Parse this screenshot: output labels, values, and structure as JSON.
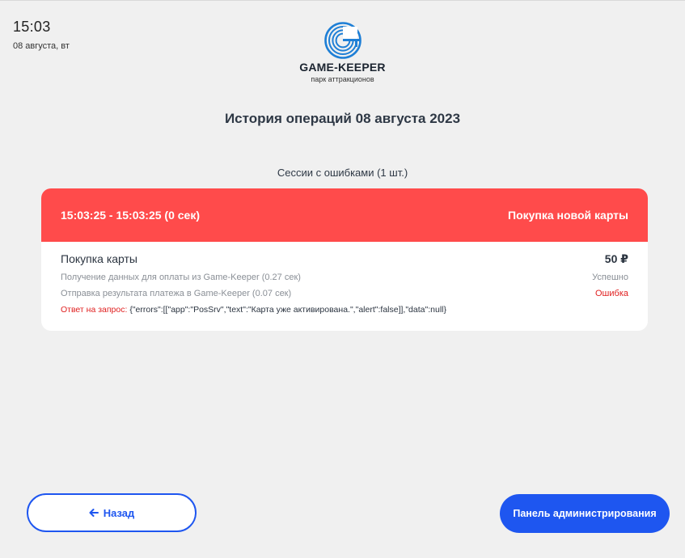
{
  "clock": {
    "time": "15:03",
    "date": "08 августа, вт"
  },
  "brand": {
    "name": "GAME-KEEPER",
    "subtitle": "парк аттракционов",
    "color": "#1e7fd6"
  },
  "page_title": "История операций 08 августа 2023",
  "section_title": "Сессии с ошибками (1 шт.)",
  "session": {
    "time_range": "15:03:25 - 15:03:25 (0 сек)",
    "operation": "Покупка новой карты",
    "header_color": "#ff4b4b",
    "item_name": "Покупка карты",
    "amount": "50 ₽",
    "steps": [
      {
        "label": "Получение данных для оплаты из Game-Keeper (0.27 сек)",
        "status": "Успешно"
      },
      {
        "label": "Отправка результата платежа в Game-Keeper (0.07 сек)",
        "status": "Ошибка"
      }
    ],
    "response_label": "Ответ на запрос:",
    "response_text": "{\"errors\":[[\"app\":\"PosSrv\",\"text\":\"Карта уже активирована.\",\"alert\":false]],\"data\":null}"
  },
  "buttons": {
    "back_label": "Назад",
    "admin_label": "Панель администрирования",
    "accent": "#1e56f0"
  }
}
